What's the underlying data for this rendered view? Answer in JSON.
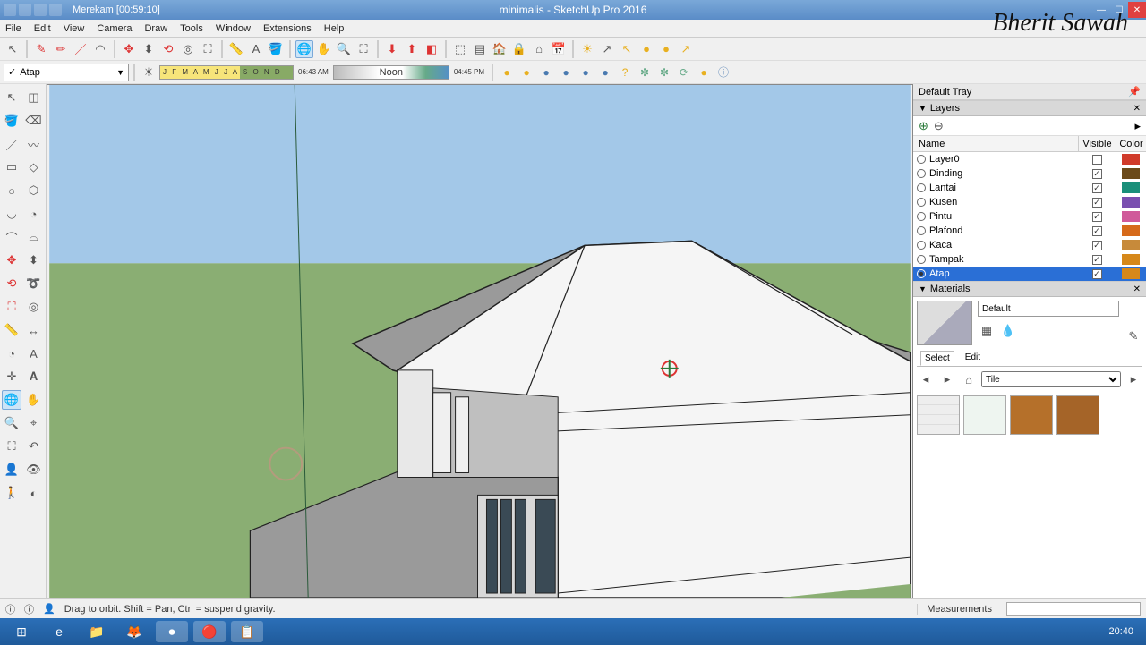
{
  "titlebar": {
    "recording": "Merekam [00:59:10]",
    "title": "minimalis - SketchUp Pro 2016",
    "watermark": "Bherit Sawah"
  },
  "menu": [
    "File",
    "Edit",
    "View",
    "Camera",
    "Draw",
    "Tools",
    "Window",
    "Extensions",
    "Help"
  ],
  "layer_combo": {
    "value": "Atap"
  },
  "shadow": {
    "months": "J F M A M J J A S O N D",
    "time_left": "06:43 AM",
    "time_mid": "Noon",
    "time_right": "04:45 PM"
  },
  "tray": {
    "title": "Default Tray",
    "layers_title": "Layers",
    "materials_title": "Materials",
    "cols": {
      "name": "Name",
      "visible": "Visible",
      "color": "Color"
    },
    "layers": [
      {
        "name": "Layer0",
        "visible": false,
        "color": "#d03a2a",
        "sel": false
      },
      {
        "name": "Dinding",
        "visible": true,
        "color": "#6b4a1a",
        "sel": false
      },
      {
        "name": "Lantai",
        "visible": true,
        "color": "#1a8f7a",
        "sel": false
      },
      {
        "name": "Kusen",
        "visible": true,
        "color": "#7a4fb0",
        "sel": false
      },
      {
        "name": "Pintu",
        "visible": true,
        "color": "#d05a9a",
        "sel": false
      },
      {
        "name": "Plafond",
        "visible": true,
        "color": "#d66a1a",
        "sel": false
      },
      {
        "name": "Kaca",
        "visible": true,
        "color": "#c78a3a",
        "sel": false
      },
      {
        "name": "Tampak",
        "visible": true,
        "color": "#d6881a",
        "sel": false
      },
      {
        "name": "Atap",
        "visible": true,
        "color": "#d6881a",
        "sel": true
      }
    ],
    "material_name": "Default",
    "select_tab": "Select",
    "edit_tab": "Edit",
    "collection": "Tile"
  },
  "status": {
    "hint": "Drag to orbit. Shift = Pan, Ctrl = suspend gravity.",
    "meas_label": "Measurements"
  },
  "taskbar": {
    "clock": "20:40"
  }
}
